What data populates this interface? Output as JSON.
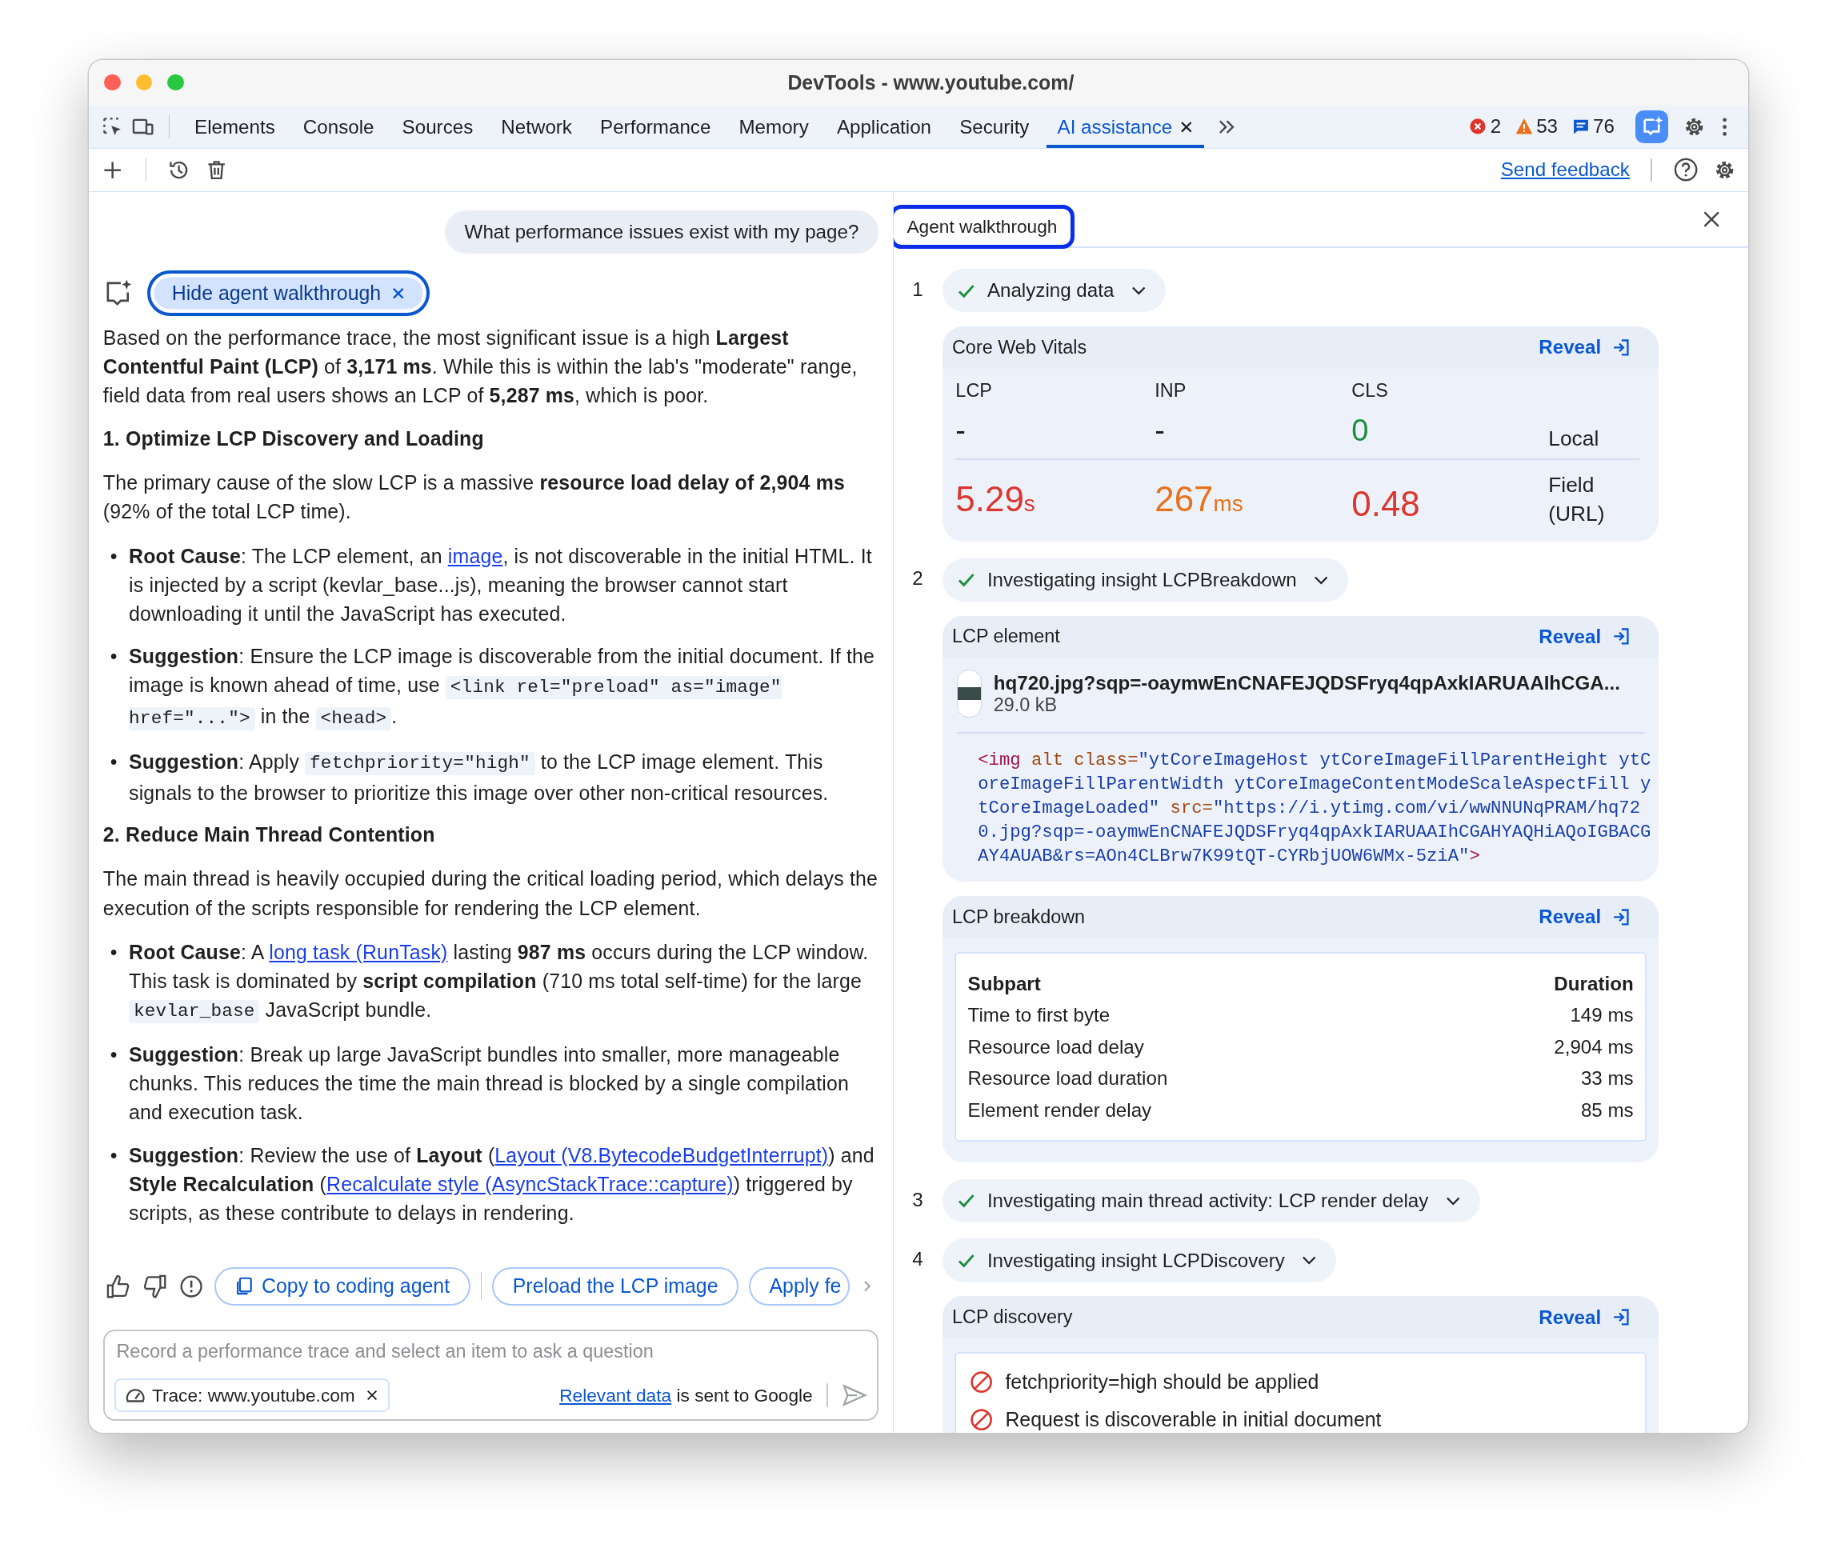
{
  "window": {
    "title": "DevTools - www.youtube.com/"
  },
  "tabs": [
    {
      "label": "Elements",
      "selected": false
    },
    {
      "label": "Console",
      "selected": false
    },
    {
      "label": "Sources",
      "selected": false
    },
    {
      "label": "Network",
      "selected": false
    },
    {
      "label": "Performance",
      "selected": false
    },
    {
      "label": "Memory",
      "selected": false
    },
    {
      "label": "Application",
      "selected": false
    },
    {
      "label": "Security",
      "selected": false
    },
    {
      "label": "AI assistance",
      "selected": true
    }
  ],
  "issues": [
    {
      "kind": "error",
      "count": "2"
    },
    {
      "kind": "warning",
      "count": "53"
    },
    {
      "kind": "info",
      "count": "76"
    }
  ],
  "toolbar": {
    "send_feedback": "Send feedback"
  },
  "chat": {
    "user_message": "What performance issues exist with my page?",
    "walkthrough_button": "Hide agent walkthrough",
    "blocks": [
      {
        "kind": "paragraph",
        "runs": [
          {
            "kind": "text",
            "text": "Based on the performance trace, the most significant issue is a high **Largest Contentful Paint (LCP)** of **3,171 ms**. While this is within the lab's \"moderate\" range, field data from real users shows an LCP of **5,287 ms**, which is poor."
          }
        ]
      },
      {
        "kind": "heading",
        "text": "1. Optimize LCP Discovery and Loading"
      },
      {
        "kind": "paragraph",
        "runs": [
          {
            "kind": "text",
            "text": "The primary cause of the slow LCP is a massive **resource load delay of 2,904 ms** (92% of the total LCP time)."
          }
        ]
      },
      {
        "kind": "bullets",
        "marker": "•",
        "items": [
          [
            {
              "kind": "text",
              "text": "**Root Cause**: The LCP element, an "
            },
            {
              "kind": "link",
              "text": "image"
            },
            {
              "kind": "text",
              "text": ", is not discoverable in the initial HTML. It is injected by a script (kevlar_base...js), meaning the browser cannot start downloading it until the JavaScript has executed."
            }
          ],
          [
            {
              "kind": "text",
              "text": "**Suggestion**: Ensure the LCP image is discoverable from the initial document. If the image is known ahead of time, use "
            },
            {
              "kind": "code",
              "text": "<link rel=\"preload\" as=\"image\" href=\"...\">"
            },
            {
              "kind": "text",
              "text": " in the "
            },
            {
              "kind": "code",
              "text": "<head>"
            },
            {
              "kind": "text",
              "text": "."
            }
          ],
          [
            {
              "kind": "text",
              "text": "**Suggestion**: Apply "
            },
            {
              "kind": "code",
              "text": "fetchpriority=\"high\""
            },
            {
              "kind": "text",
              "text": " to the LCP image element. This signals to the browser to prioritize this image over other non-critical resources."
            }
          ]
        ]
      },
      {
        "kind": "heading",
        "text": "2. Reduce Main Thread Contention"
      },
      {
        "kind": "paragraph",
        "runs": [
          {
            "kind": "text",
            "text": "The main thread is heavily occupied during the critical loading period, which delays the execution of the scripts responsible for rendering the LCP element."
          }
        ]
      },
      {
        "kind": "bullets",
        "marker": "•",
        "items": [
          [
            {
              "kind": "text",
              "text": "**Root Cause**: A "
            },
            {
              "kind": "link",
              "text": "long task (RunTask)"
            },
            {
              "kind": "text",
              "text": " lasting **987 ms** occurs during the LCP window. This task is dominated by **script compilation** (710 ms total self-time) for the large "
            },
            {
              "kind": "code",
              "text": "kevlar_base"
            },
            {
              "kind": "text",
              "text": " JavaScript bundle."
            }
          ],
          [
            {
              "kind": "text",
              "text": "**Suggestion**: Break up large JavaScript bundles into smaller, more manageable chunks. This reduces the time the main thread is blocked by a single compilation and execution task."
            }
          ],
          [
            {
              "kind": "text",
              "text": "**Suggestion**: Review the use of **Layout** ("
            },
            {
              "kind": "link",
              "text": "Layout (V8.BytecodeBudgetInterrupt)"
            },
            {
              "kind": "text",
              "text": ") and **Style Recalculation** ("
            },
            {
              "kind": "link",
              "text": "Recalculate style (AsyncStackTrace::capture)"
            },
            {
              "kind": "text",
              "text": ") triggered by scripts, as these contribute to delays in rendering."
            }
          ]
        ]
      }
    ],
    "suggestions": [
      {
        "label": "Copy to coding agent",
        "kind": "copy"
      },
      {
        "label": "Preload the LCP image",
        "kind": "plain"
      },
      {
        "label": "Apply fe",
        "kind": "plain"
      }
    ],
    "input": {
      "placeholder": "Record a performance trace and select an item to ask a question",
      "context": "Trace: www.youtube.com",
      "disclaimer_link": "Relevant data",
      "disclaimer": " is sent to Google"
    }
  },
  "walkthrough": {
    "title": "Agent walkthrough",
    "steps": [
      {
        "number": "1",
        "title": "Analyzing data",
        "done": true,
        "cards": [
          {
            "kind": "vitals",
            "title": "Core Web Vitals",
            "reveal": "Reveal",
            "row_labels": [
              "Local",
              "Field (URL)"
            ],
            "metrics": [
              {
                "name": "LCP",
                "local": {
                  "value": "-",
                  "color": "#1f1f1f"
                },
                "field": {
                  "value": "5.29",
                  "unit": "s",
                  "color": "#dc362e"
                }
              },
              {
                "name": "INP",
                "local": {
                  "value": "-",
                  "color": "#1f1f1f"
                },
                "field": {
                  "value": "267",
                  "unit": "ms",
                  "color": "#e8711a"
                }
              },
              {
                "name": "CLS",
                "local": {
                  "value": "0",
                  "color": "#1e8e3e"
                },
                "field": {
                  "value": "0.48",
                  "color": "#dc362e"
                }
              }
            ]
          }
        ]
      },
      {
        "number": "2",
        "title": "Investigating insight LCPBreakdown",
        "done": true,
        "cards": [
          {
            "kind": "element",
            "title": "LCP element",
            "reveal": "Reveal",
            "file": "hq720.jpg?sqp=-oaymwEnCNAFEJQDSFryq4qpAxkIARUAAIhCGA...",
            "size": "29.0 kB",
            "code": [
              {
                "kind": "tag",
                "text": "<img"
              },
              {
                "kind": "attr",
                "text": " alt class="
              },
              {
                "kind": "string",
                "text": "\"ytCoreImageHost ytCoreImageFillParentHeight ytCoreImageFillParentWidth ytCoreImageContentModeScaleAspectFill ytCoreImageLoaded\""
              },
              {
                "kind": "attr",
                "text": " src="
              },
              {
                "kind": "string",
                "text": "\"https://i.ytimg.com/vi/wwNNUNqPRAM/hq720.jpg?sqp=-oaymwEnCNAFEJQDSFryq4qpAxkIARUAAIhCGAHYAQHiAQoIGBACGAY4AUAB&rs=AOn4CLBrw7K99tQT-CYRbjUOW6WMx-5ziA\""
              },
              {
                "kind": "tag",
                "text": ">"
              }
            ]
          },
          {
            "kind": "breakdown",
            "title": "LCP breakdown",
            "reveal": "Reveal",
            "columns": [
              "Subpart",
              "Duration"
            ],
            "rows": [
              [
                "Time to first byte",
                "149 ms"
              ],
              [
                "Resource load delay",
                "2,904 ms"
              ],
              [
                "Resource load duration",
                "33 ms"
              ],
              [
                "Element render delay",
                "85 ms"
              ]
            ]
          }
        ]
      },
      {
        "number": "3",
        "title": "Investigating main thread activity: LCP render delay",
        "done": true
      },
      {
        "number": "4",
        "title": "Investigating insight LCPDiscovery",
        "done": true,
        "cards": [
          {
            "kind": "discovery",
            "title": "LCP discovery",
            "reveal": "Reveal",
            "checks": [
              {
                "text": "fetchpriority=high should be applied",
                "passed": false
              },
              {
                "text": "Request is discoverable in initial document",
                "passed": false
              }
            ]
          }
        ]
      }
    ]
  }
}
